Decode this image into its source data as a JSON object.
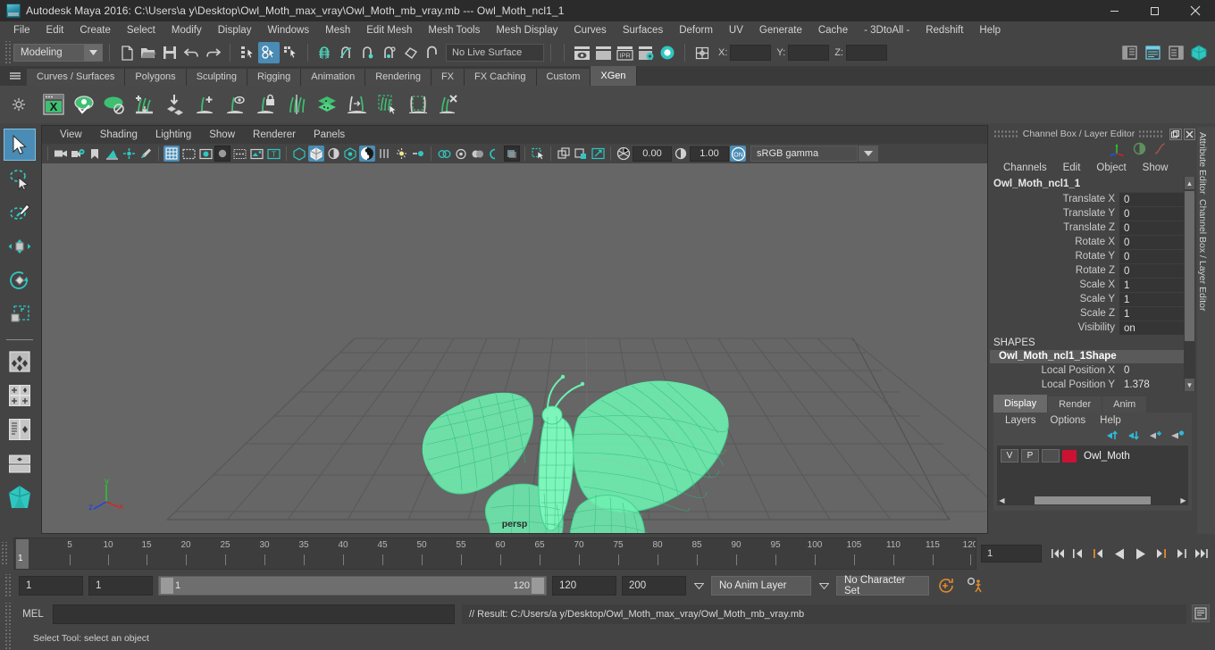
{
  "window": {
    "title": "Autodesk Maya 2016: C:\\Users\\a y\\Desktop\\Owl_Moth_max_vray\\Owl_Moth_mb_vray.mb  ---  Owl_Moth_ncl1_1",
    "minimize": "–",
    "maximize": "❐",
    "close": "✕"
  },
  "menubar": {
    "items": [
      {
        "label": "File"
      },
      {
        "label": "Edit"
      },
      {
        "label": "Create"
      },
      {
        "label": "Select"
      },
      {
        "label": "Modify"
      },
      {
        "label": "Display"
      },
      {
        "label": "Windows"
      },
      {
        "label": "Mesh"
      },
      {
        "label": "Edit Mesh"
      },
      {
        "label": "Mesh Tools"
      },
      {
        "label": "Mesh Display"
      },
      {
        "label": "Curves"
      },
      {
        "label": "Surfaces"
      },
      {
        "label": "Deform"
      },
      {
        "label": "UV"
      },
      {
        "label": "Generate"
      },
      {
        "label": "Cache"
      },
      {
        "label": "- 3DtoAll -"
      },
      {
        "label": "Redshift"
      },
      {
        "label": "Help"
      }
    ]
  },
  "statusbar": {
    "menuset": "Modeling",
    "live_surface": "No Live Surface",
    "coord_x_label": "X:",
    "coord_y_label": "Y:",
    "coord_z_label": "Z:",
    "coord_x": "",
    "coord_y": "",
    "coord_z": ""
  },
  "shelf": {
    "tabs": [
      {
        "label": "Curves / Surfaces",
        "active": false
      },
      {
        "label": "Polygons",
        "active": false
      },
      {
        "label": "Sculpting",
        "active": false
      },
      {
        "label": "Rigging",
        "active": false
      },
      {
        "label": "Animation",
        "active": false
      },
      {
        "label": "Rendering",
        "active": false
      },
      {
        "label": "FX",
        "active": false
      },
      {
        "label": "FX Caching",
        "active": false
      },
      {
        "label": "Custom",
        "active": false
      },
      {
        "label": "XGen",
        "active": true
      }
    ],
    "icons": [
      "xgen-window-icon",
      "preview-on-icon",
      "preview-off-icon",
      "add-description-icon",
      "export-patches-icon",
      "add-guide-icon",
      "guide-visibility-icon",
      "lock-guide-icon",
      "mirror-guide-icon",
      "layers-icon",
      "convert-to-interactive-icon",
      "select-region-icon",
      "select-box-icon",
      "delete-guide-icon"
    ]
  },
  "tools": {
    "items": [
      {
        "name": "select-tool",
        "selected": true
      },
      {
        "name": "lasso-select-tool",
        "selected": false
      },
      {
        "name": "paint-select-tool",
        "selected": false
      },
      {
        "name": "move-tool",
        "selected": false
      },
      {
        "name": "rotate-tool",
        "selected": false
      },
      {
        "name": "scale-tool",
        "selected": false
      },
      {
        "name": "last-tool-icon",
        "selected": false
      }
    ]
  },
  "viewport": {
    "menu": [
      {
        "label": "View"
      },
      {
        "label": "Shading"
      },
      {
        "label": "Lighting"
      },
      {
        "label": "Show"
      },
      {
        "label": "Renderer"
      },
      {
        "label": "Panels"
      }
    ],
    "exposure": "0.00",
    "gamma": "1.00",
    "color_profile": "sRGB gamma",
    "camera_label": "persp",
    "axis_x": "x",
    "axis_y": "y",
    "axis_z": "z",
    "mesh_color": "#6ef0b0",
    "background": "#666666"
  },
  "channelbox": {
    "panel_title": "Channel Box / Layer Editor",
    "menu": [
      {
        "label": "Channels"
      },
      {
        "label": "Edit"
      },
      {
        "label": "Object"
      },
      {
        "label": "Show"
      }
    ],
    "node_name": "Owl_Moth_ncl1_1",
    "attributes": [
      {
        "label": "Translate X",
        "value": "0"
      },
      {
        "label": "Translate Y",
        "value": "0"
      },
      {
        "label": "Translate Z",
        "value": "0"
      },
      {
        "label": "Rotate X",
        "value": "0"
      },
      {
        "label": "Rotate Y",
        "value": "0"
      },
      {
        "label": "Rotate Z",
        "value": "0"
      },
      {
        "label": "Scale X",
        "value": "1"
      },
      {
        "label": "Scale Y",
        "value": "1"
      },
      {
        "label": "Scale Z",
        "value": "1"
      },
      {
        "label": "Visibility",
        "value": "on"
      }
    ],
    "shapes_header": "SHAPES",
    "shape_name": "Owl_Moth_ncl1_1Shape",
    "shape_attributes": [
      {
        "label": "Local Position X",
        "value": "0"
      },
      {
        "label": "Local Position Y",
        "value": "1.378"
      }
    ]
  },
  "layer_editor": {
    "tabs": [
      {
        "label": "Display",
        "active": true
      },
      {
        "label": "Render",
        "active": false
      },
      {
        "label": "Anim",
        "active": false
      }
    ],
    "menu": [
      {
        "label": "Layers"
      },
      {
        "label": "Options"
      },
      {
        "label": "Help"
      }
    ],
    "buttons": [
      "move-layer-up-icon",
      "move-layer-down-icon",
      "new-layer-icon",
      "new-layer-from-selected-icon"
    ],
    "layers": [
      {
        "visibility": "V",
        "playback": "P",
        "shading": "",
        "color": "#cc1133",
        "name": "Owl_Moth"
      }
    ]
  },
  "attribute_editor": {
    "label_top": "Attribute Editor",
    "label_bottom": "Channel Box / Layer Editor"
  },
  "timeline": {
    "ticks": [
      5,
      10,
      15,
      20,
      25,
      30,
      35,
      40,
      45,
      50,
      55,
      60,
      65,
      70,
      75,
      80,
      85,
      90,
      95,
      100,
      105,
      110,
      115,
      120
    ],
    "current_frame": "1",
    "frame_field": "1",
    "playback": [
      "go-to-start-icon",
      "step-back-keyframe-icon",
      "step-back-frame-icon",
      "play-backwards-icon",
      "play-forwards-icon",
      "step-forward-frame-icon",
      "step-forward-keyframe-icon",
      "go-to-end-icon"
    ]
  },
  "range": {
    "start": "1",
    "playback_start": "1",
    "slider_start": "1",
    "slider_end": "120",
    "playback_end": "120",
    "end": "200",
    "anim_layer": "No Anim Layer",
    "character_set": "No Character Set",
    "auto_key_icon": "auto-keyframe-icon",
    "anim_prefs_icon": "animation-preferences-icon"
  },
  "commandline": {
    "mel_label": "MEL",
    "mel_input": "",
    "mel_placeholder": "",
    "result": "// Result: C:/Users/a y/Desktop/Owl_Moth_max_vray/Owl_Moth_mb_vray.mb",
    "script_editor_icon": "script-editor-icon"
  },
  "helpline": {
    "text": "Select Tool: select an object"
  }
}
